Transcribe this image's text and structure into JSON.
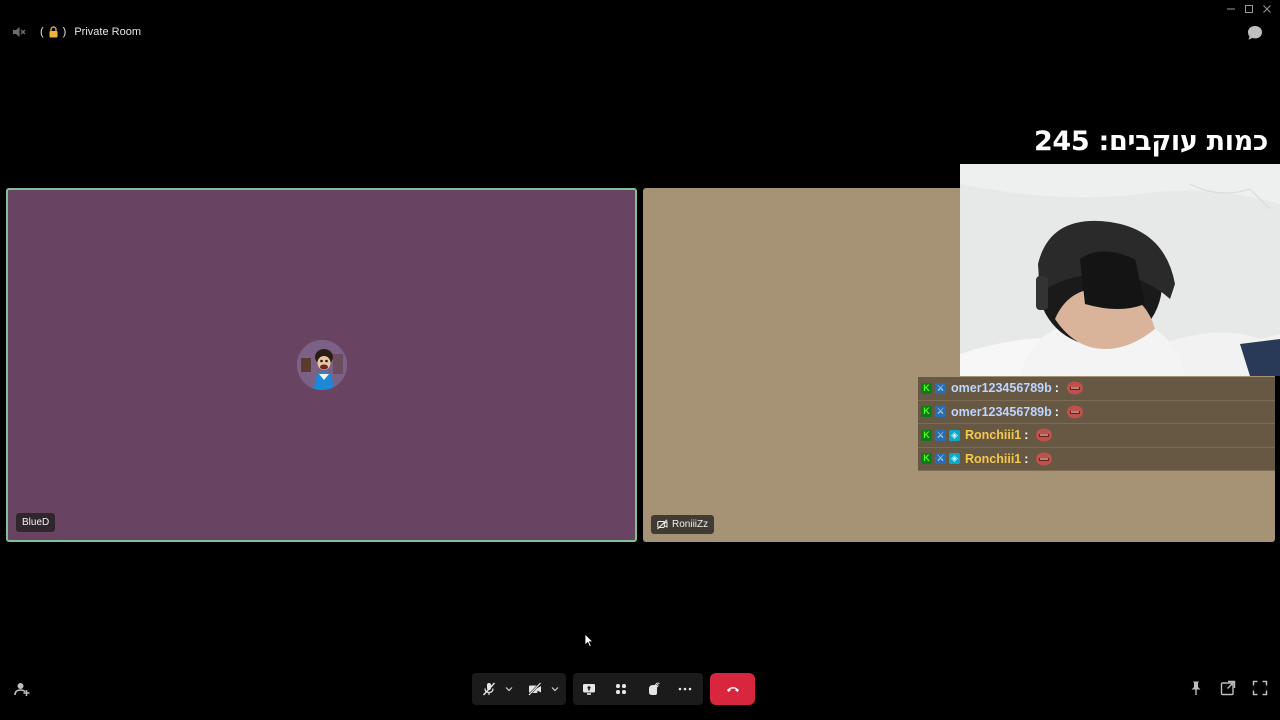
{
  "window": {
    "controls": [
      "minimize-icon",
      "maximize-icon",
      "close-icon"
    ]
  },
  "topbar": {
    "room_name": "Private Room",
    "paren_open": "(",
    "paren_close": ")",
    "icons": [
      "speaker-muted-icon",
      "lock-icon",
      "chat-icon"
    ]
  },
  "overlay": {
    "followers_text": "כמות עוקבים: 245"
  },
  "tiles": [
    {
      "name": "BlueD",
      "bg": "#684462",
      "active_border": "#7fc29a"
    },
    {
      "name": "RoniiiZz",
      "bg": "#a69275",
      "icon": "camera-off-icon"
    }
  ],
  "chat": {
    "messages": [
      {
        "user": "omer123456789b",
        "sep": ":",
        "color": "#bcd6ff",
        "badges": [
          "kick",
          "mod"
        ],
        "emote": "red-face-emote"
      },
      {
        "user": "omer123456789b",
        "sep": ":",
        "color": "#bcd6ff",
        "badges": [
          "kick",
          "mod"
        ],
        "emote": "red-face-emote"
      },
      {
        "user": "Ronchiii1",
        "sep": ":",
        "color": "#f5c84b",
        "badges": [
          "kick",
          "mod",
          "vip"
        ],
        "emote": "red-face-emote"
      },
      {
        "user": "Ronchiii1",
        "sep": ":",
        "color": "#f5c84b",
        "badges": [
          "kick",
          "mod",
          "vip"
        ],
        "emote": "red-face-emote"
      }
    ]
  },
  "toolbar": {
    "groups": [
      [
        "mic-muted-icon",
        "chevron-down-icon",
        "camera-off-icon",
        "chevron-down-icon"
      ],
      [
        "screen-share-icon",
        "activities-icon",
        "soundboard-icon",
        "more-icon"
      ]
    ],
    "leave_icon": "phone-hangup-icon",
    "leave_color": "#d7263d"
  },
  "bottom_right": [
    "pin-icon",
    "popout-icon",
    "fullscreen-icon"
  ],
  "bottom_left": "add-user-icon",
  "colors": {
    "background": "#000000",
    "toolbar_bg": "#1b1b1b"
  }
}
